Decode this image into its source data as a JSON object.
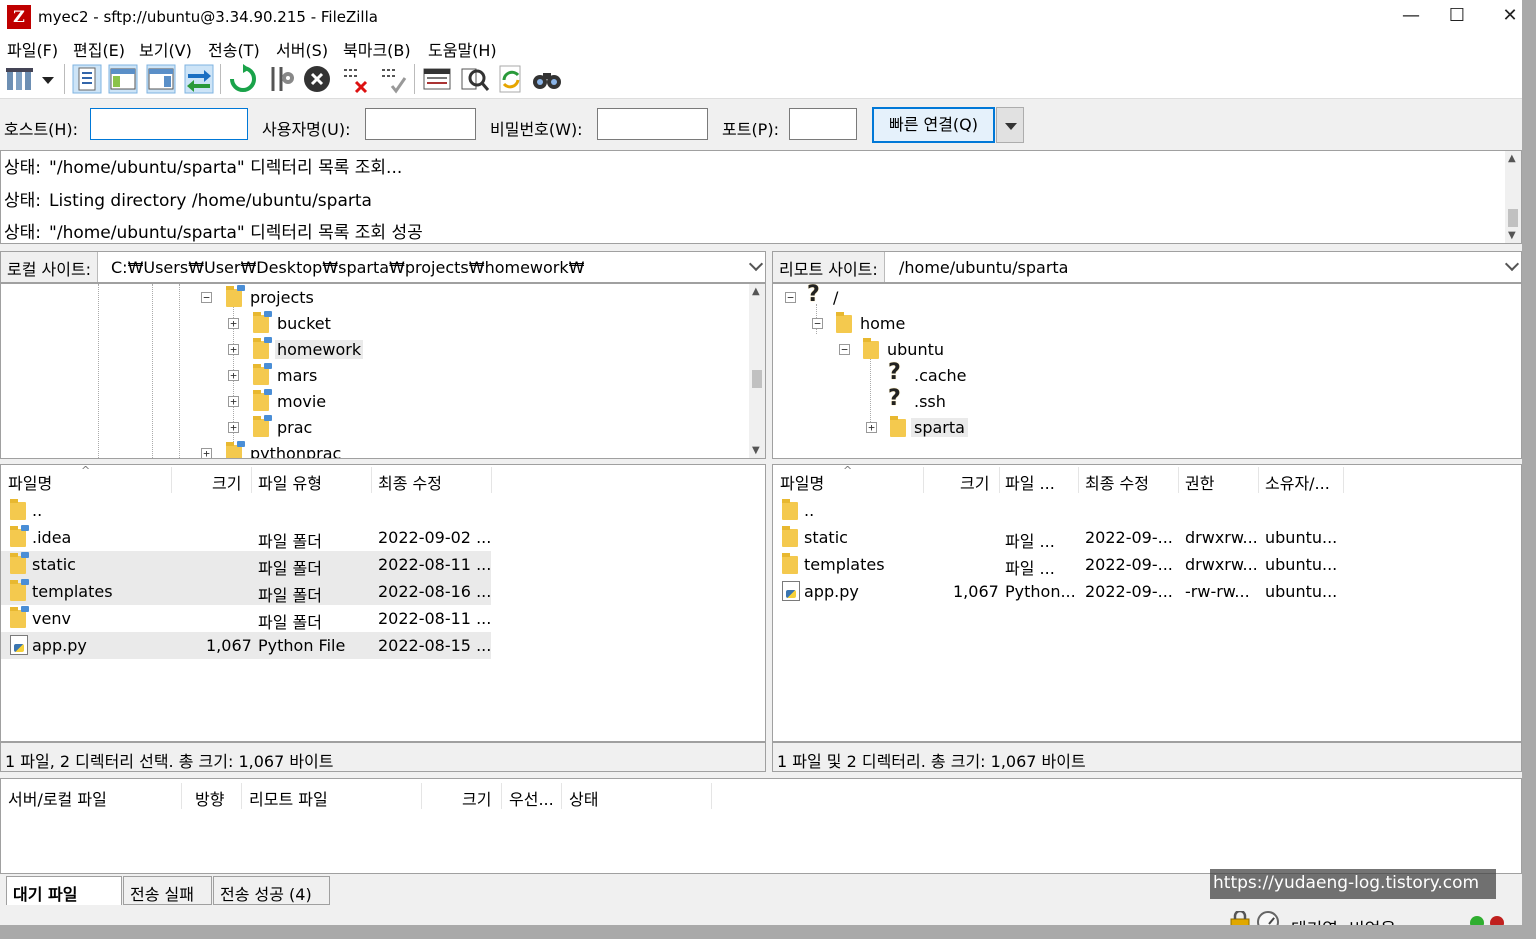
{
  "window": {
    "title": "myec2 - sftp://ubuntu@3.34.90.215 - FileZilla",
    "app_icon_letter": "Z",
    "minimize": "—",
    "maximize": "☐",
    "close": "✕"
  },
  "menu": [
    "파일(F)",
    "편집(E)",
    "보기(V)",
    "전송(T)",
    "서버(S)",
    "북마크(B)",
    "도움말(H)"
  ],
  "toolbar": {
    "icons": [
      "site-manager-icon",
      "dropdown-arrow-icon",
      "toggle-message-log-icon",
      "toggle-local-tree-icon",
      "toggle-remote-tree-icon",
      "toggle-queue-icon",
      "refresh-icon",
      "process-queue-icon",
      "cancel-icon",
      "disconnect-icon",
      "reconnect-icon",
      "directory-listing-filters-icon",
      "compare-icon",
      "sync-browse-icon",
      "search-icon"
    ]
  },
  "quickconnect": {
    "host_label": "호스트(H):",
    "host_value": "",
    "user_label": "사용자명(U):",
    "user_value": "",
    "pass_label": "비밀번호(W):",
    "pass_value": "",
    "port_label": "포트(P):",
    "port_value": "",
    "connect_button": "빠른 연결(Q)"
  },
  "log": [
    {
      "kind": "상태:",
      "text": "\"/home/ubuntu/sparta\" 디렉터리 목록 조회..."
    },
    {
      "kind": "상태:",
      "text": "Listing directory /home/ubuntu/sparta"
    },
    {
      "kind": "상태:",
      "text": "\"/home/ubuntu/sparta\" 디렉터리 목록 조회 성공"
    }
  ],
  "local": {
    "site_label": "로컬 사이트:",
    "path": "C:₩Users₩User₩Desktop₩sparta₩projects₩homework₩",
    "tree": [
      {
        "label": "projects",
        "expander": "−"
      },
      {
        "label": "bucket",
        "expander": "+"
      },
      {
        "label": "homework",
        "expander": "+"
      },
      {
        "label": "mars",
        "expander": "+"
      },
      {
        "label": "movie",
        "expander": "+"
      },
      {
        "label": "prac",
        "expander": "+"
      },
      {
        "label": "pythonprac",
        "expander": "+"
      }
    ],
    "columns": {
      "name": "파일명",
      "size": "크기",
      "type": "파일 유형",
      "modified": "최종 수정"
    },
    "files": [
      {
        "name": "..",
        "size": "",
        "type": "",
        "modified": ""
      },
      {
        "name": ".idea",
        "size": "",
        "type": "파일 폴더",
        "modified": "2022-09-02 ..."
      },
      {
        "name": "static",
        "size": "",
        "type": "파일 폴더",
        "modified": "2022-08-11 ..."
      },
      {
        "name": "templates",
        "size": "",
        "type": "파일 폴더",
        "modified": "2022-08-16 ..."
      },
      {
        "name": "venv",
        "size": "",
        "type": "파일 폴더",
        "modified": "2022-08-11 ..."
      },
      {
        "name": "app.py",
        "size": "1,067",
        "type": "Python File",
        "modified": "2022-08-15 ..."
      }
    ],
    "status": "1 파일, 2 디렉터리 선택. 총 크기: 1,067 바이트"
  },
  "remote": {
    "site_label": "리모트 사이트:",
    "path": "/home/ubuntu/sparta",
    "tree": [
      {
        "label": "/",
        "expander": "−"
      },
      {
        "label": "home",
        "expander": "−"
      },
      {
        "label": "ubuntu",
        "expander": "−"
      },
      {
        "label": ".cache",
        "expander": ""
      },
      {
        "label": ".ssh",
        "expander": ""
      },
      {
        "label": "sparta",
        "expander": "+"
      }
    ],
    "columns": {
      "name": "파일명",
      "size": "크기",
      "type": "파일 ...",
      "modified": "최종 수정",
      "perms": "권한",
      "owner": "소유자/..."
    },
    "files": [
      {
        "name": "..",
        "size": "",
        "type": "",
        "modified": "",
        "perms": "",
        "owner": ""
      },
      {
        "name": "static",
        "size": "",
        "type": "파일 ...",
        "modified": "2022-09-...",
        "perms": "drwxrw...",
        "owner": "ubuntu..."
      },
      {
        "name": "templates",
        "size": "",
        "type": "파일 ...",
        "modified": "2022-09-...",
        "perms": "drwxrw...",
        "owner": "ubuntu..."
      },
      {
        "name": "app.py",
        "size": "1,067",
        "type": "Python...",
        "modified": "2022-09-...",
        "perms": "-rw-rw...",
        "owner": "ubuntu..."
      }
    ],
    "status": "1 파일 및 2 디렉터리. 총 크기: 1,067 바이트"
  },
  "queue": {
    "columns": [
      "서버/로컬 파일",
      "방향",
      "리모트 파일",
      "크기",
      "우선...",
      "상태"
    ]
  },
  "tabs": [
    "대기 파일",
    "전송 실패",
    "전송 성공 (4)"
  ],
  "watermark": "https://yudaeng-log.tistory.com",
  "bottom": {
    "queue_status": "대기열: 비었음"
  },
  "colors": {
    "accent": "#0078d7",
    "folder": "#f4c94e",
    "selected_row": "#eaeaea",
    "led_green": "#2fae2f",
    "led_red": "#c0201e"
  }
}
